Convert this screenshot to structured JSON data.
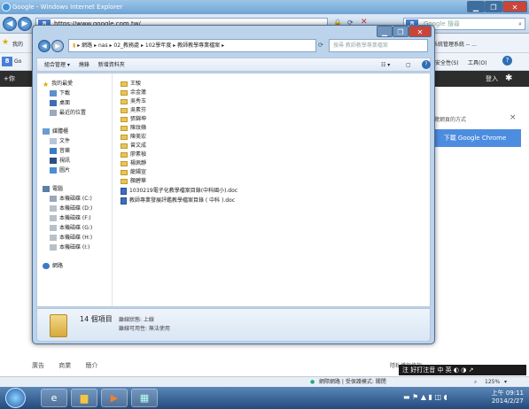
{
  "ie": {
    "title": "Google - Windows Internet Explorer",
    "url": "https://www.google.com.tw/",
    "search_placeholder": "Google 搜尋",
    "fav_text": "我的",
    "fav_right": "系統管理系統 -- ...",
    "cmd_right_safety": "安全性(S)",
    "cmd_right_tools": "工具(O)",
    "tab_left": "Go",
    "black_left": "+你",
    "black_right": "登入",
    "status_zone": "網際網路 | 受保護模式: 關閉",
    "zoom": "125%"
  },
  "page": {
    "promo_text": "瀏覽網頁的方式",
    "promo_button": "下載 Google Chrome",
    "footer": [
      "廣告",
      "商業",
      "簡介"
    ],
    "footer_right": "隱私權與條款"
  },
  "explorer": {
    "path": [
      "網路",
      "nas",
      "02_教務處",
      "102學年度",
      "教師教學專業檔案"
    ],
    "search_placeholder": "搜尋 教師教學專業檔案",
    "toolbar": [
      "組合管理 ▾",
      "燒錄",
      "新增資料夾"
    ],
    "nav": {
      "favorites_header": "我的最愛",
      "favorites": [
        "下載",
        "桌面",
        "最近的位置"
      ],
      "libraries_header": "媒體櫃",
      "libraries": [
        "文件",
        "音樂",
        "視訊",
        "圖片"
      ],
      "computer_header": "電腦",
      "drives": [
        "本機磁碟 (C:)",
        "本機磁碟 (D:)",
        "本機磁碟 (F:)",
        "本機磁碟 (G:)",
        "本機磁碟 (H:)",
        "本機磁碟 (I:)"
      ],
      "network": "網路"
    },
    "folders": [
      "王駿",
      "余金蓮",
      "吳秀玉",
      "吳素芬",
      "張錦坤",
      "陳玟蘋",
      "陳美宏",
      "曾文成",
      "廖素楨",
      "楊佩靜",
      "龍鍚宣",
      "顏碧華"
    ],
    "docs": [
      "1030219電子化教學檔案目錄(中科國小).doc",
      "教師專業發展評鑑教學檔案目錄 ( 中科 ).doc"
    ],
    "details": {
      "count": "14 個項目",
      "state": "離線狀態: 上線",
      "availability": "離線可用性: 無法使用"
    }
  },
  "ime": "注 好打注音  中 英 ◐ ◑ ↗",
  "clock": {
    "time": "上午 09:11",
    "date": "2014/2/27"
  }
}
